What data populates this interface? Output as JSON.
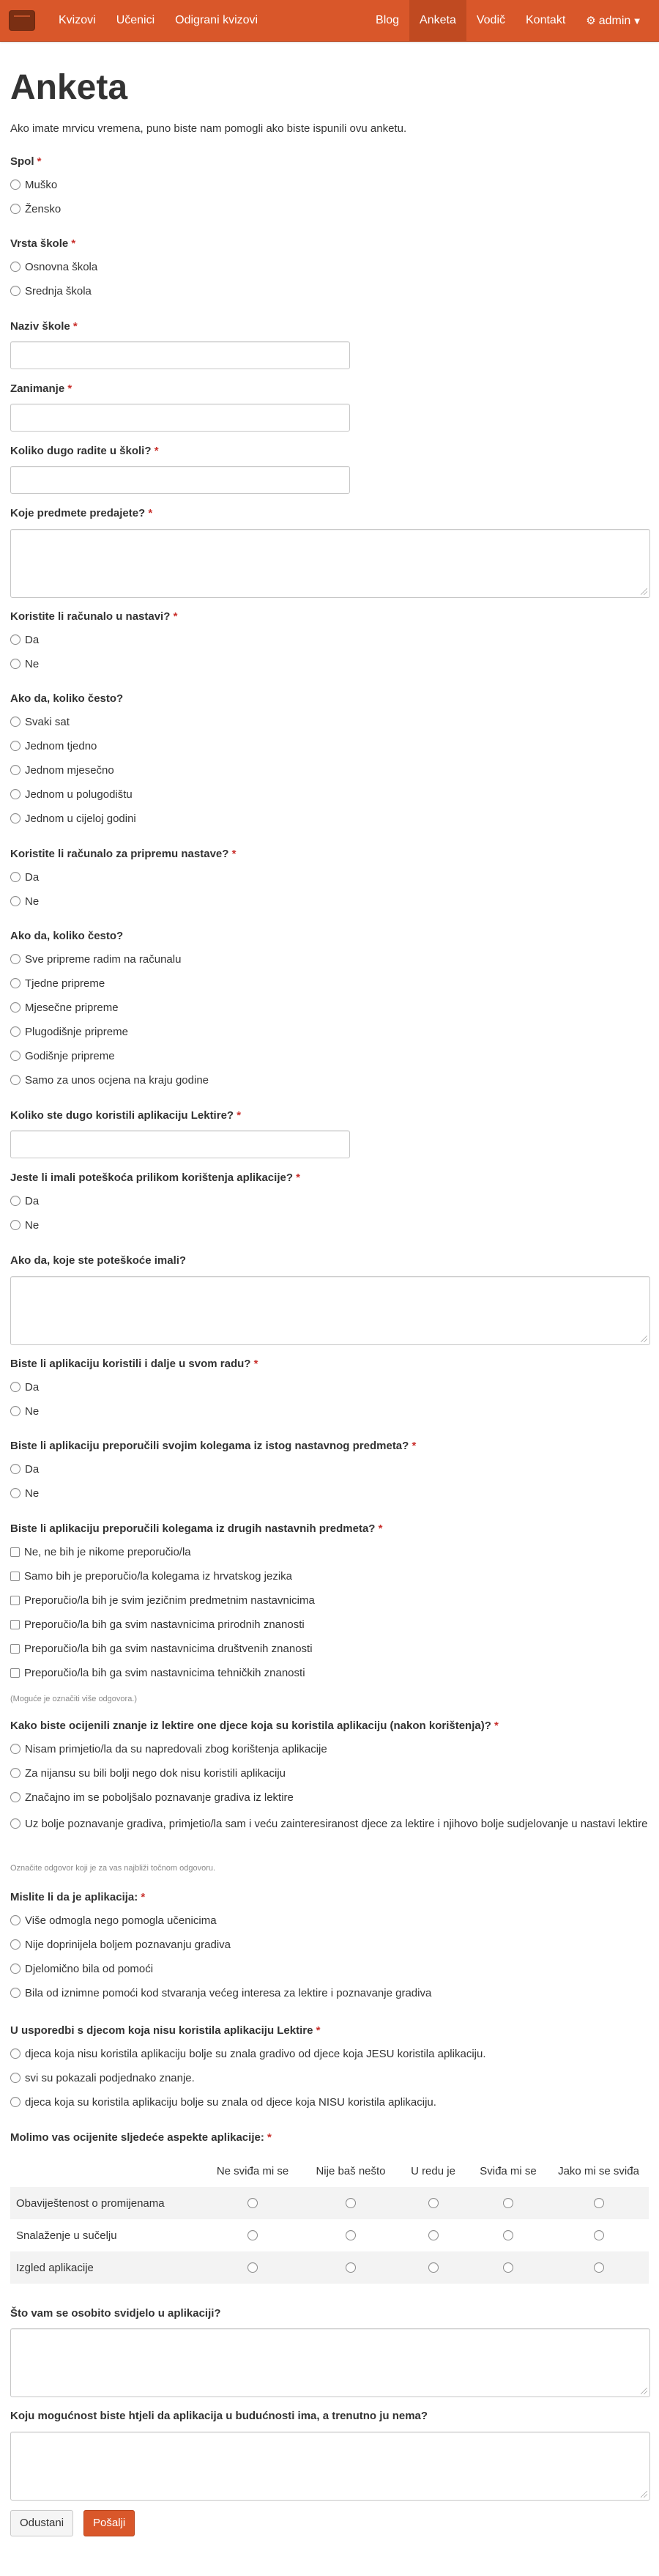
{
  "nav": {
    "left": [
      "Kvizovi",
      "Učenici",
      "Odigrani kvizovi"
    ],
    "right": [
      "Blog",
      "Anketa",
      "Vodič",
      "Kontakt"
    ],
    "admin_label": "admin",
    "active": "Anketa",
    "brand_color": "#d9572a"
  },
  "page": {
    "title": "Anketa",
    "intro": "Ako imate mrvicu vremena, puno biste nam pomogli ako biste ispunili ovu anketu.",
    "required_mark": "*"
  },
  "questions": {
    "spol": {
      "label": "Spol",
      "options": [
        "Muško",
        "Žensko"
      ]
    },
    "vrsta_skole": {
      "label": "Vrsta škole",
      "options": [
        "Osnovna škola",
        "Srednja škola"
      ]
    },
    "naziv_skole": {
      "label": "Naziv škole"
    },
    "zanimanje": {
      "label": "Zanimanje"
    },
    "koliko_dugo": {
      "label": "Koliko dugo radite u školi?"
    },
    "predmeti": {
      "label": "Koje predmete predajete?"
    },
    "racunalo_nastava": {
      "label": "Koristite li računalo u nastavi?",
      "options": [
        "Da",
        "Ne"
      ]
    },
    "racunalo_cesto": {
      "label": "Ako da, koliko često?",
      "options": [
        "Svaki sat",
        "Jednom tjedno",
        "Jednom mjesečno",
        "Jednom u polugodištu",
        "Jednom u cijeloj godini"
      ]
    },
    "racunalo_priprema": {
      "label": "Koristite li računalo za pripremu nastave?",
      "options": [
        "Da",
        "Ne"
      ]
    },
    "priprema_cesto": {
      "label": "Ako da, koliko često?",
      "options": [
        "Sve pripreme radim na računalu",
        "Tjedne pripreme",
        "Mjesečne pripreme",
        "Plugodišnje pripreme",
        "Godišnje pripreme",
        "Samo za unos ocjena na kraju godine"
      ]
    },
    "lektire_dugo": {
      "label": "Koliko ste dugo koristili aplikaciju Lektire?"
    },
    "poteskoce": {
      "label": "Jeste li imali poteškoća prilikom korištenja aplikacije?",
      "options": [
        "Da",
        "Ne"
      ]
    },
    "koje_poteskoce": {
      "label": "Ako da, koje ste poteškoće imali?"
    },
    "dalje_koristili": {
      "label": "Biste li aplikaciju koristili i dalje u svom radu?",
      "options": [
        "Da",
        "Ne"
      ]
    },
    "preporucili_isti": {
      "label": "Biste li aplikaciju preporučili svojim kolegama iz istog nastavnog predmeta?",
      "options": [
        "Da",
        "Ne"
      ]
    },
    "preporucili_drugi": {
      "label": "Biste li aplikaciju preporučili kolegama iz drugih nastavnih predmeta?",
      "options": [
        "Ne, ne bih je nikome preporučio/la",
        "Samo bih je preporučio/la kolegama iz hrvatskog jezika",
        "Preporučio/la bih je svim jezičnim predmetnim nastavnicima",
        "Preporučio/la bih ga svim nastavnicima prirodnih znanosti",
        "Preporučio/la bih ga svim nastavnicima društvenih znanosti",
        "Preporučio/la bih ga svim nastavnicima tehničkih znanosti"
      ],
      "help": "(Moguće je označiti više odgovora.)"
    },
    "znanje": {
      "label": "Kako biste ocijenili znanje iz lektire one djece koja su koristila aplikaciju (nakon korištenja)?",
      "options": [
        "Nisam primjetio/la da su napredovali zbog korištenja aplikacije",
        "Za nijansu su bili bolji nego dok nisu koristili aplikaciju",
        "Značajno im se poboljšalo poznavanje gradiva iz lektire",
        "Uz bolje poznavanje gradiva, primjetio/la sam i veću zainteresiranost djece za lektire i njihovo bolje sudjelovanje u nastavi lektire"
      ],
      "help": "Označite odgovor koji je za vas najbliži točnom odgovoru."
    },
    "mislite": {
      "label": "Mislite li da je aplikacija:",
      "options": [
        "Više odmogla nego pomogla učenicima",
        "Nije doprinijela boljem poznavanju gradiva",
        "Djelomično bila od pomoći",
        "Bila od iznimne pomoći kod stvaranja većeg interesa za lektire i poznavanje gradiva"
      ]
    },
    "usporedbi": {
      "label": "U usporedbi s djecom koja nisu koristila aplikaciju Lektire",
      "options": [
        "djeca koja nisu koristila aplikaciju bolje su znala gradivo od djece koja JESU koristila aplikaciju.",
        "svi su pokazali podjednako znanje.",
        "djeca koja su koristila aplikaciju bolje su znala od djece koja NISU koristila aplikaciju."
      ]
    },
    "ocijenite": {
      "label": "Molimo vas ocijenite sljedeće aspekte aplikacije:",
      "columns": [
        "Ne sviđa mi se",
        "Nije baš nešto",
        "U redu je",
        "Sviđa mi se",
        "Jako mi se sviđa"
      ],
      "rows": [
        "Obaviještenost o promijenama",
        "Snalaženje u sučelju",
        "Izgled aplikacije"
      ]
    },
    "svidjelo": {
      "label": "Što vam se osobito svidjelo u aplikaciji?"
    },
    "mogucnost": {
      "label": "Koju mogućnost biste htjeli da aplikacija u budućnosti ima, a trenutno ju nema?"
    }
  },
  "buttons": {
    "cancel": "Odustani",
    "submit": "Pošalji"
  }
}
